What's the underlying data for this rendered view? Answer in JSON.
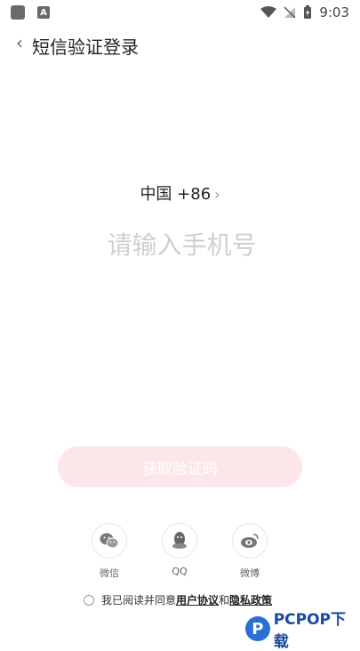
{
  "status_bar": {
    "time": "9:03",
    "app_badge": "A"
  },
  "header": {
    "title": "短信验证登录"
  },
  "region": {
    "label": "中国 +86"
  },
  "phone": {
    "placeholder": "请输入手机号"
  },
  "get_code": {
    "label": "获取验证码"
  },
  "social": [
    {
      "label": "微信",
      "icon": "wechat-icon"
    },
    {
      "label": "QQ",
      "icon": "qq-icon"
    },
    {
      "label": "微博",
      "icon": "weibo-icon"
    }
  ],
  "agreement": {
    "prefix": "我已阅读并同意",
    "user_agreement": "用户协议",
    "and": "和",
    "privacy_policy": "隐私政策"
  },
  "watermark": {
    "text": "PCPOP下载"
  },
  "colors": {
    "button_bg": "#fde6ea",
    "placeholder": "#cfcfcf",
    "watermark": "#1b4aa0"
  }
}
